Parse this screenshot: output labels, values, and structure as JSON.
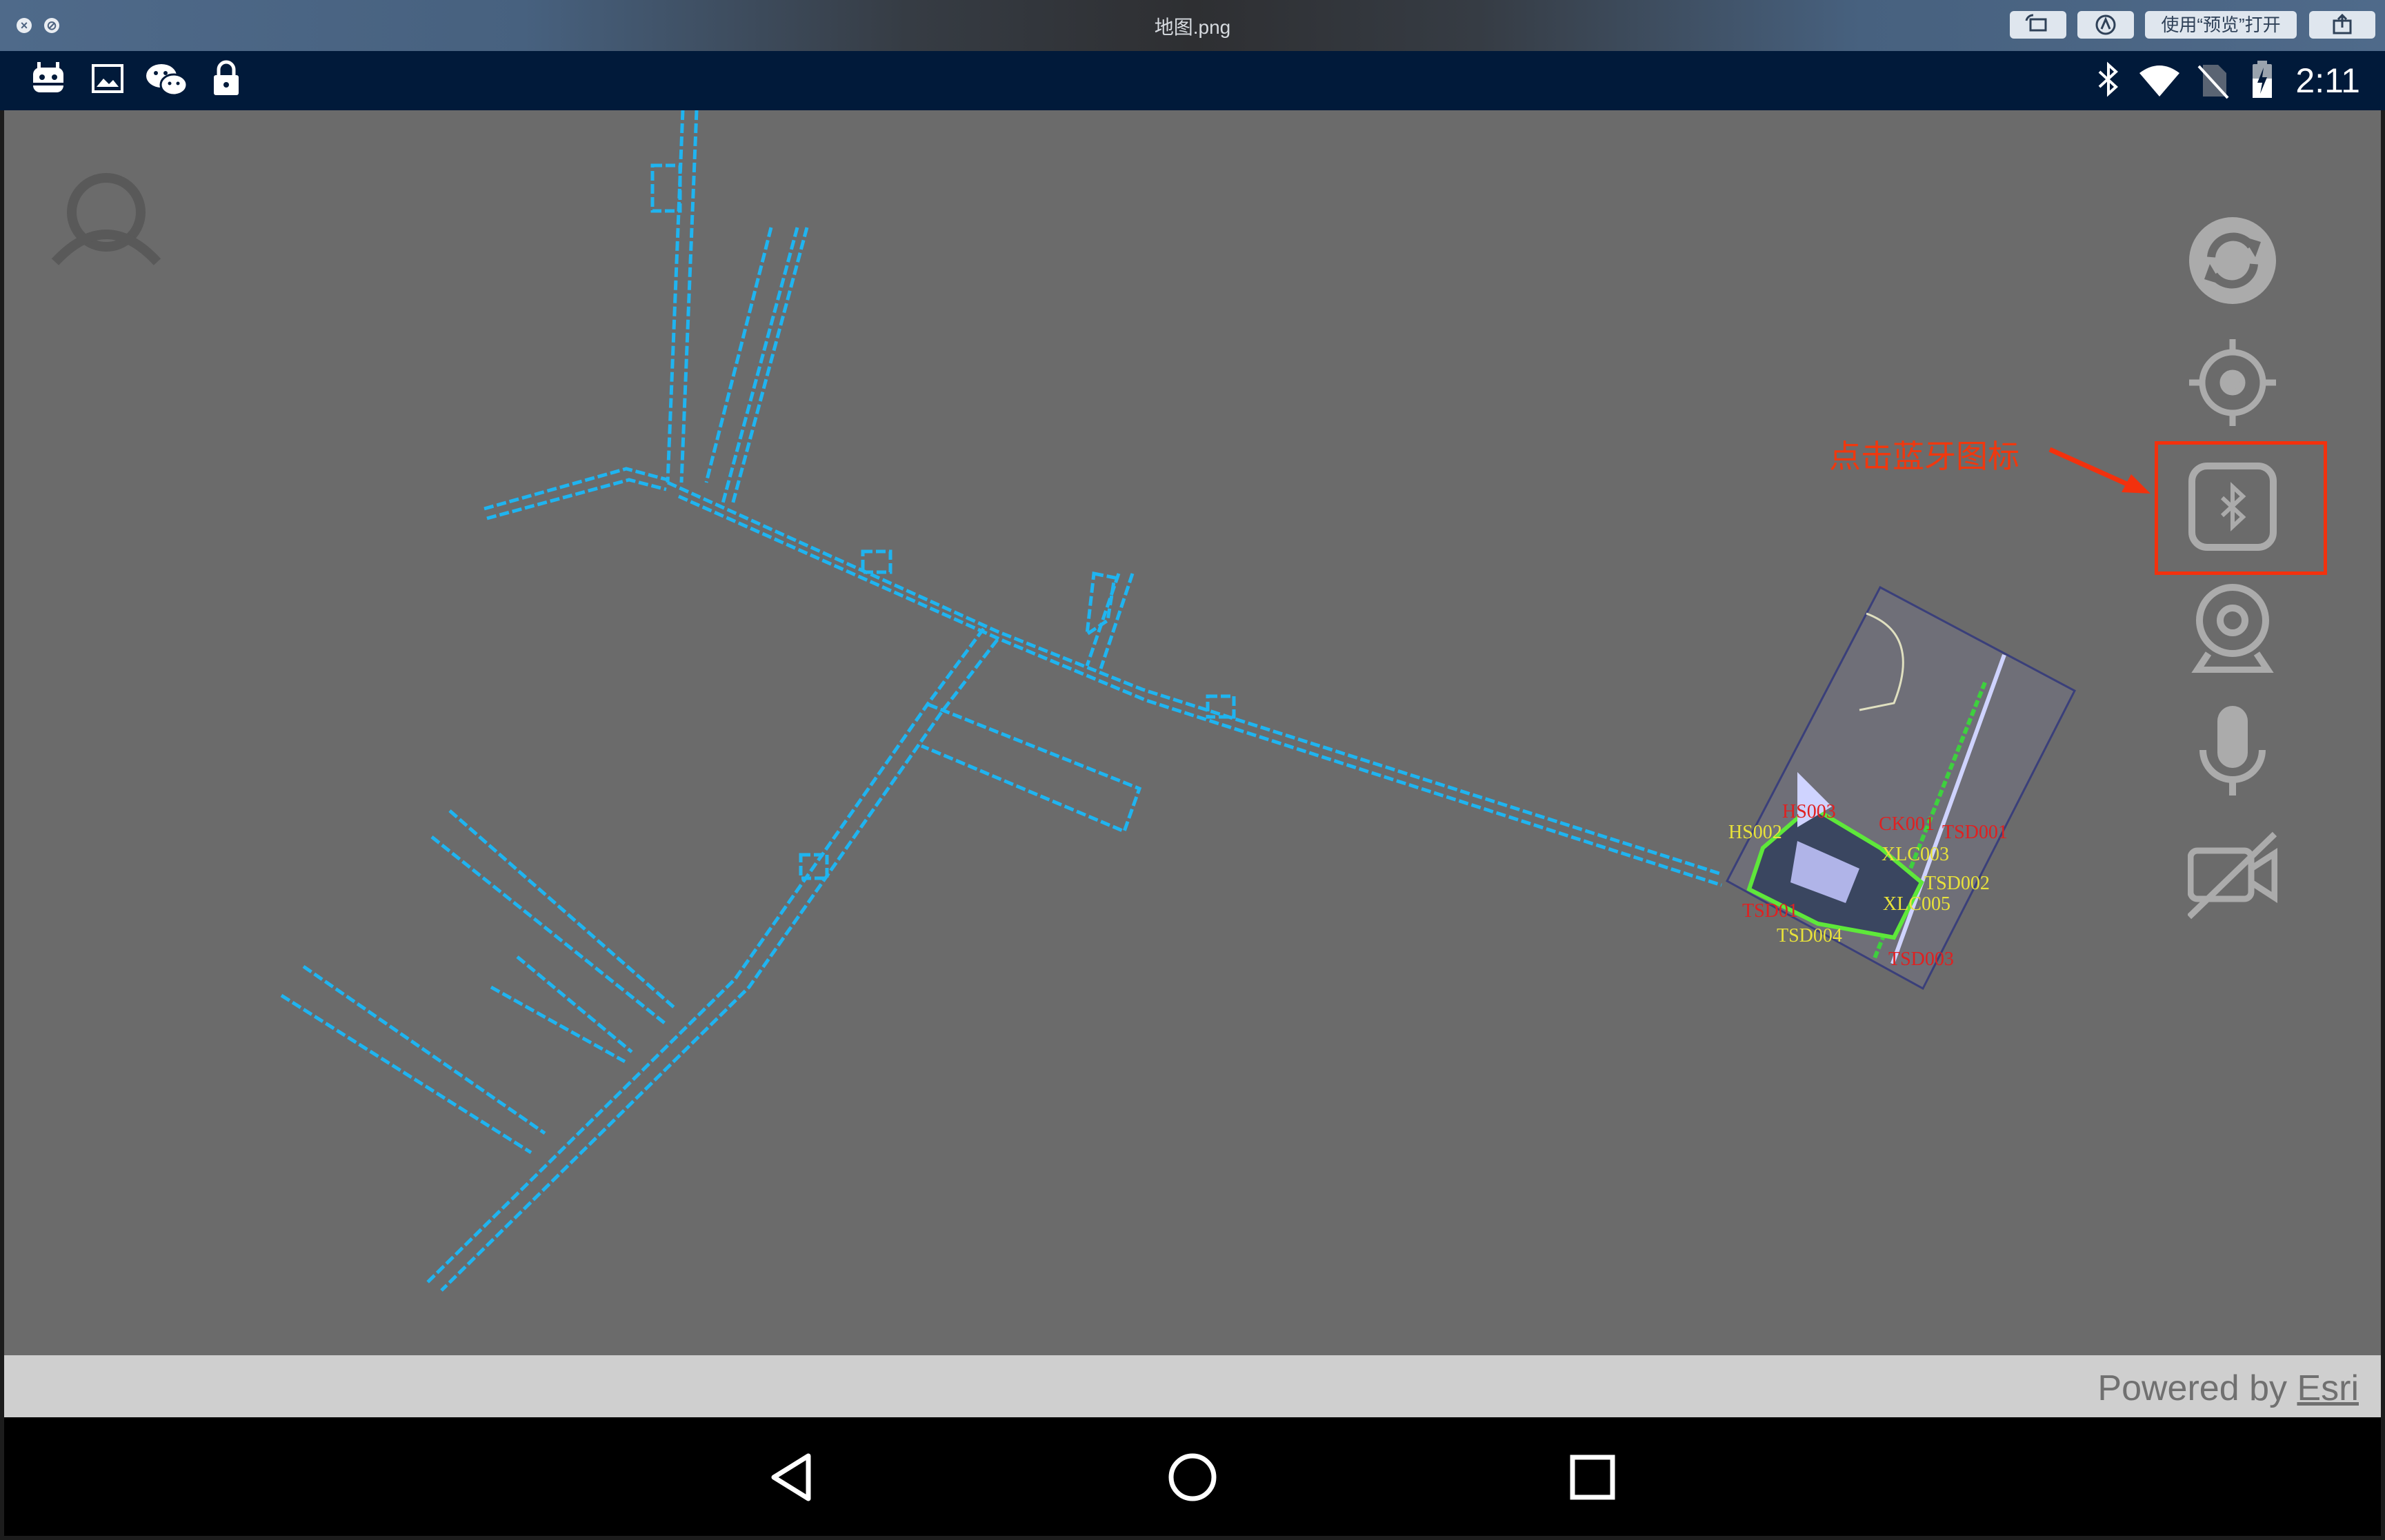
{
  "window": {
    "title": "地图.png",
    "open_with_label": "使用“预览”打开"
  },
  "status_bar": {
    "time": "2:11",
    "left_icons": [
      "android-notification-icon",
      "image-icon",
      "wechat-icon",
      "lock-icon"
    ],
    "right_icons": [
      "bluetooth-icon",
      "wifi-icon",
      "no-sim-icon",
      "battery-charging-icon"
    ]
  },
  "map": {
    "background_color": "#6b6b6b",
    "line_color": "#1fb4f0",
    "labels": [
      {
        "text": "HS002",
        "color": "#e8e23a"
      },
      {
        "text": "HS003",
        "color": "#e02020"
      },
      {
        "text": "CK001",
        "color": "#e02020"
      },
      {
        "text": "TSD001",
        "color": "#e02020"
      },
      {
        "text": "XLC003",
        "color": "#e8e23a"
      },
      {
        "text": "TSD002",
        "color": "#e8e23a"
      },
      {
        "text": "XLC005",
        "color": "#e8e23a"
      },
      {
        "text": "TSD01",
        "color": "#e02020"
      },
      {
        "text": "TSD004",
        "color": "#e8e23a"
      },
      {
        "text": "TSD003",
        "color": "#e02020"
      }
    ]
  },
  "controls": {
    "buttons": [
      "refresh-icon",
      "locate-icon",
      "bluetooth-icon",
      "webcam-icon",
      "microphone-icon",
      "video-off-icon"
    ]
  },
  "annotation": {
    "text": "点击蓝牙图标",
    "color": "#f0380e"
  },
  "attribution": {
    "prefix": "Powered by ",
    "brand": "Esri"
  },
  "navigation": {
    "buttons": [
      "back-icon",
      "home-icon",
      "recents-icon"
    ]
  }
}
